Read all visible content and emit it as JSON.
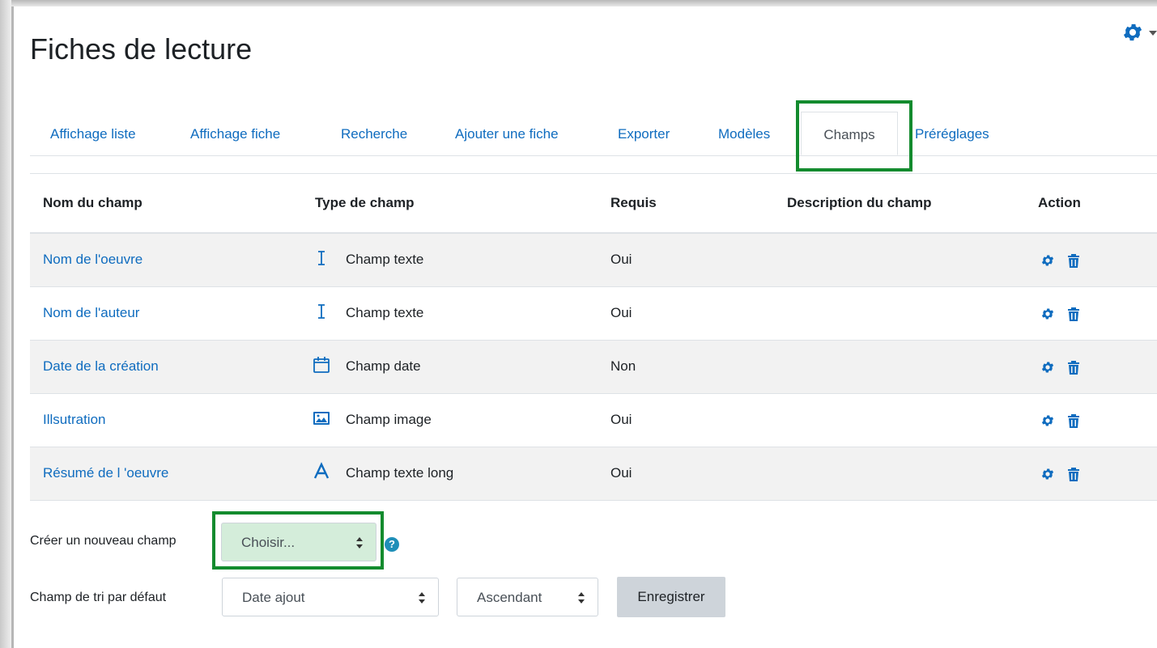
{
  "page": {
    "title": "Fiches de lecture"
  },
  "tabs": [
    {
      "label": "Affichage liste"
    },
    {
      "label": "Affichage fiche"
    },
    {
      "label": "Recherche"
    },
    {
      "label": "Ajouter une fiche"
    },
    {
      "label": "Exporter"
    },
    {
      "label": "Modèles"
    },
    {
      "label": "Champs",
      "active": true
    },
    {
      "label": "Préréglages"
    }
  ],
  "table": {
    "headers": [
      "Nom du champ",
      "Type de champ",
      "Requis",
      "Description du champ",
      "Action"
    ],
    "rows": [
      {
        "name": "Nom de l'oeuvre",
        "type_icon": "text-cursor-icon",
        "type": "Champ texte",
        "required": "Oui",
        "description": ""
      },
      {
        "name": "Nom de l'auteur",
        "type_icon": "text-cursor-icon",
        "type": "Champ texte",
        "required": "Oui",
        "description": ""
      },
      {
        "name": "Date de la création",
        "type_icon": "calendar-icon",
        "type": "Champ date",
        "required": "Non",
        "description": ""
      },
      {
        "name": "Illsutration",
        "type_icon": "image-icon",
        "type": "Champ image",
        "required": "Oui",
        "description": ""
      },
      {
        "name": "Résumé de l 'oeuvre",
        "type_icon": "letter-a-icon",
        "type": "Champ texte long",
        "required": "Oui",
        "description": ""
      }
    ]
  },
  "create_field": {
    "label": "Créer un nouveau champ",
    "select_value": "Choisir...",
    "help": "?"
  },
  "sort": {
    "label": "Champ de tri par défaut",
    "field_value": "Date ajout",
    "order_value": "Ascendant",
    "save_label": "Enregistrer"
  },
  "colors": {
    "link": "#0f6cbf",
    "highlight": "#138b2e",
    "stripe": "#f2f2f2"
  }
}
